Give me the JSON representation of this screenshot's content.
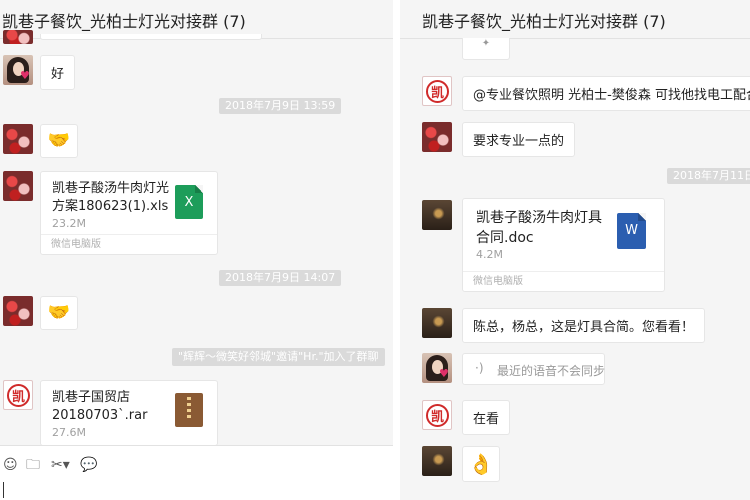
{
  "left_chat": {
    "title": "凯巷子餐饮_光柏士灯光对接群 (7)",
    "messages": [
      {
        "type": "text",
        "text": "好"
      },
      {
        "type": "time",
        "text": "2018年7月9日 13:59"
      },
      {
        "type": "emoji",
        "icon": "handshake-emoji",
        "glyph": "🤝"
      },
      {
        "type": "file",
        "name_line1": "凯巷子酸汤牛肉灯光",
        "name_line2": "方案180623(1).xls",
        "size": "23.2M",
        "source": "微信电脑版",
        "file_icon": "excel-file-icon",
        "file_glyph": "X"
      },
      {
        "type": "time",
        "text": "2018年7月9日 14:07"
      },
      {
        "type": "emoji",
        "icon": "handshake-emoji",
        "glyph": "🤝"
      },
      {
        "type": "system",
        "text": "\"辉辉～微笑好邻城\"邀请\"Hr.\"加入了群聊"
      },
      {
        "type": "file",
        "name_line1": "凯巷子国贸店",
        "name_line2": "20180703`.rar",
        "size": "27.6M",
        "file_icon": "archive-file-icon"
      }
    ],
    "toolbar": [
      {
        "name": "emoji-picker-icon",
        "glyph": "☺"
      },
      {
        "name": "folder-icon",
        "glyph": "🗀"
      },
      {
        "name": "screenshot-scissors-icon",
        "glyph": "✂▾"
      },
      {
        "name": "chat-history-icon",
        "glyph": "💬"
      }
    ]
  },
  "right_chat": {
    "title": "凯巷子餐饮_光柏士灯光对接群 (7)",
    "messages": [
      {
        "type": "text",
        "text": "@专业餐饮照明 光柏士-樊俊森 可找他找电工配合"
      },
      {
        "type": "text",
        "text": "要求专业一点的"
      },
      {
        "type": "time",
        "text": "2018年7月11日"
      },
      {
        "type": "file",
        "name_line1": "凯巷子酸汤牛肉灯具",
        "name_line2": "合同.doc",
        "size": "4.2M",
        "source": "微信电脑版",
        "file_icon": "word-file-icon",
        "file_glyph": "W"
      },
      {
        "type": "text",
        "text": "陈总，杨总，这是灯具合简。您看看！"
      },
      {
        "type": "voice",
        "text": "最近的语音不会同步",
        "glyph": "·)"
      },
      {
        "type": "text",
        "text": "在看"
      },
      {
        "type": "emoji",
        "icon": "ok-hand-emoji",
        "glyph": "👌"
      }
    ]
  },
  "colors": {
    "chat_background": "#f5f5f5",
    "bubble": "#ffffff",
    "timestamp_pill": "#dadada",
    "excel": "#1d9d5a",
    "word": "#2b5eb0",
    "archive": "#8a5a34"
  }
}
